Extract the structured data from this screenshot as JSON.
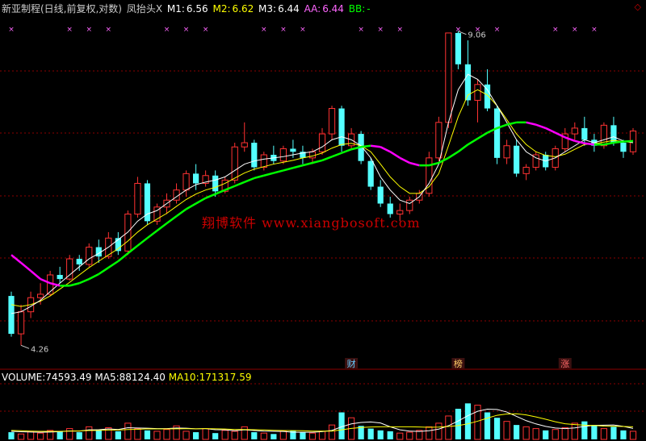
{
  "header": {
    "title": "新亚制程(日线,前复权,对数)",
    "indicator": "凤抬头X",
    "m1_label": "M1:",
    "m1": "6.56",
    "m2_label": "M2:",
    "m2": "6.62",
    "m3_label": "M3:",
    "m3": "6.44",
    "aa_label": "AA:",
    "aa": "6.44",
    "bb_label": "BB:",
    "bb": "-"
  },
  "volume_header": {
    "vol_label": "VOLUME:",
    "vol": "74593.49",
    "ma5_label": "MA5:",
    "ma5": "88124.40",
    "ma10_label": "MA10:",
    "ma10": "171317.59"
  },
  "watermark": "翔博软件 www.xiangbosoft.com",
  "corner_icon": "diamond-icon",
  "annotations": {
    "high": "9.06",
    "low": "4.26"
  },
  "markers": [
    "财",
    "榜",
    "涨"
  ],
  "colors": {
    "up": "#ff3232",
    "down": "#54ffff",
    "flat": "#ffffff",
    "grid": "#8b0000",
    "m1": "#ffffff",
    "m2": "#ffff00",
    "aa_up": "#00ff00",
    "aa_down": "#ff00ff",
    "marker_x": "#ff66ff",
    "label_m1": "#ffffff",
    "label_m2": "#ffff00",
    "label_aa": "#ff66ff",
    "label_ma10": "#ffff00",
    "label_title": "#cccccc"
  },
  "chart_data": [
    {
      "type": "candlestick",
      "title": "新亚制程(日线,前复权,对数)",
      "ylim": [
        4.1,
        9.4
      ],
      "log_scale": true,
      "grid": true,
      "candles": [
        [
          4.8,
          4.85,
          4.35,
          4.38
        ],
        [
          4.38,
          4.7,
          4.26,
          4.62
        ],
        [
          4.62,
          4.85,
          4.55,
          4.78
        ],
        [
          4.78,
          4.95,
          4.7,
          4.82
        ],
        [
          4.82,
          5.1,
          4.8,
          5.05
        ],
        [
          5.05,
          5.15,
          4.95,
          5.0
        ],
        [
          5.0,
          5.3,
          4.98,
          5.25
        ],
        [
          5.25,
          5.3,
          5.1,
          5.18
        ],
        [
          5.18,
          5.45,
          5.15,
          5.4
        ],
        [
          5.4,
          5.5,
          5.2,
          5.28
        ],
        [
          5.28,
          5.6,
          5.25,
          5.52
        ],
        [
          5.52,
          5.6,
          5.3,
          5.35
        ],
        [
          5.35,
          5.9,
          5.3,
          5.85
        ],
        [
          5.85,
          6.4,
          5.8,
          6.3
        ],
        [
          6.3,
          6.35,
          5.7,
          5.75
        ],
        [
          5.75,
          6.0,
          5.7,
          5.95
        ],
        [
          5.95,
          6.15,
          5.85,
          6.05
        ],
        [
          6.05,
          6.3,
          6.0,
          6.2
        ],
        [
          6.2,
          6.5,
          6.1,
          6.45
        ],
        [
          6.45,
          6.6,
          6.2,
          6.3
        ],
        [
          6.3,
          6.5,
          6.25,
          6.42
        ],
        [
          6.42,
          6.5,
          6.1,
          6.18
        ],
        [
          6.18,
          6.4,
          6.15,
          6.35
        ],
        [
          6.35,
          6.95,
          6.3,
          6.88
        ],
        [
          6.88,
          7.3,
          6.8,
          6.95
        ],
        [
          6.95,
          7.0,
          6.5,
          6.55
        ],
        [
          6.55,
          6.8,
          6.5,
          6.75
        ],
        [
          6.75,
          6.9,
          6.6,
          6.65
        ],
        [
          6.65,
          6.9,
          6.6,
          6.85
        ],
        [
          6.85,
          7.0,
          6.7,
          6.8
        ],
        [
          6.8,
          6.9,
          6.6,
          6.7
        ],
        [
          6.7,
          6.85,
          6.6,
          6.8
        ],
        [
          6.8,
          7.2,
          6.75,
          7.1
        ],
        [
          7.1,
          7.6,
          7.0,
          7.55
        ],
        [
          7.55,
          7.6,
          6.8,
          6.9
        ],
        [
          6.9,
          7.2,
          6.85,
          7.1
        ],
        [
          7.1,
          7.15,
          6.6,
          6.65
        ],
        [
          6.65,
          6.7,
          6.2,
          6.25
        ],
        [
          6.25,
          6.35,
          5.95,
          6.0
        ],
        [
          6.0,
          6.1,
          5.8,
          5.85
        ],
        [
          5.85,
          6.0,
          5.75,
          5.9
        ],
        [
          5.9,
          6.1,
          5.85,
          6.05
        ],
        [
          6.05,
          6.2,
          6.0,
          6.15
        ],
        [
          6.15,
          6.8,
          6.1,
          6.7
        ],
        [
          6.7,
          7.4,
          6.65,
          7.3
        ],
        [
          7.3,
          9.06,
          7.2,
          9.06
        ],
        [
          9.06,
          9.1,
          8.3,
          8.4
        ],
        [
          8.4,
          8.9,
          7.6,
          7.7
        ],
        [
          7.7,
          8.1,
          7.3,
          8.0
        ],
        [
          8.0,
          8.3,
          7.5,
          7.55
        ],
        [
          7.55,
          7.6,
          6.6,
          6.7
        ],
        [
          6.7,
          7.0,
          6.6,
          6.9
        ],
        [
          6.9,
          7.0,
          6.4,
          6.45
        ],
        [
          6.45,
          6.6,
          6.35,
          6.55
        ],
        [
          6.55,
          6.8,
          6.5,
          6.75
        ],
        [
          6.75,
          6.8,
          6.5,
          6.55
        ],
        [
          6.55,
          6.9,
          6.5,
          6.85
        ],
        [
          6.85,
          7.2,
          6.8,
          7.1
        ],
        [
          7.1,
          7.3,
          7.0,
          7.2
        ],
        [
          7.2,
          7.4,
          6.9,
          7.0
        ],
        [
          7.0,
          7.1,
          6.8,
          6.9
        ],
        [
          6.9,
          7.3,
          6.85,
          7.25
        ],
        [
          7.25,
          7.4,
          6.9,
          6.95
        ],
        [
          6.95,
          7.0,
          6.7,
          6.8
        ],
        [
          6.8,
          7.2,
          6.75,
          7.15
        ]
      ],
      "series": [
        {
          "name": "M1",
          "values": [
            4.6,
            4.62,
            4.68,
            4.75,
            4.85,
            4.95,
            5.05,
            5.15,
            5.25,
            5.32,
            5.4,
            5.5,
            5.6,
            5.75,
            5.85,
            5.9,
            6.0,
            6.1,
            6.2,
            6.28,
            6.32,
            6.35,
            6.4,
            6.5,
            6.6,
            6.65,
            6.68,
            6.7,
            6.72,
            6.75,
            6.78,
            6.8,
            6.88,
            7.0,
            7.05,
            7.0,
            6.9,
            6.7,
            6.4,
            6.2,
            6.05,
            6.0,
            6.1,
            6.3,
            6.6,
            7.3,
            7.9,
            8.2,
            8.1,
            7.9,
            7.6,
            7.3,
            7.0,
            6.8,
            6.7,
            6.65,
            6.7,
            6.8,
            6.9,
            7.0,
            6.95,
            7.0,
            7.05,
            6.98,
            6.95
          ]
        },
        {
          "name": "M2",
          "values": [
            4.7,
            4.68,
            4.7,
            4.74,
            4.8,
            4.88,
            4.96,
            5.05,
            5.14,
            5.22,
            5.3,
            5.38,
            5.48,
            5.6,
            5.7,
            5.78,
            5.86,
            5.96,
            6.06,
            6.14,
            6.2,
            6.24,
            6.3,
            6.38,
            6.46,
            6.52,
            6.56,
            6.6,
            6.63,
            6.66,
            6.7,
            6.73,
            6.78,
            6.86,
            6.92,
            6.94,
            6.9,
            6.8,
            6.6,
            6.4,
            6.25,
            6.15,
            6.15,
            6.25,
            6.45,
            6.9,
            7.4,
            7.8,
            7.9,
            7.8,
            7.6,
            7.35,
            7.1,
            6.92,
            6.8,
            6.74,
            6.72,
            6.76,
            6.84,
            6.92,
            6.93,
            6.96,
            6.99,
            6.97,
            6.95
          ]
        },
        {
          "name": "AA",
          "values": [
            5.3,
            5.2,
            5.1,
            5.0,
            4.95,
            4.92,
            4.92,
            4.95,
            5.0,
            5.06,
            5.14,
            5.22,
            5.32,
            5.42,
            5.52,
            5.62,
            5.72,
            5.82,
            5.92,
            6.0,
            6.08,
            6.14,
            6.2,
            6.26,
            6.32,
            6.38,
            6.42,
            6.46,
            6.5,
            6.54,
            6.58,
            6.62,
            6.66,
            6.72,
            6.78,
            6.84,
            6.88,
            6.9,
            6.88,
            6.8,
            6.7,
            6.62,
            6.58,
            6.58,
            6.62,
            6.7,
            6.8,
            6.92,
            7.02,
            7.12,
            7.2,
            7.26,
            7.3,
            7.3,
            7.26,
            7.2,
            7.12,
            7.04,
            6.98,
            6.94,
            6.92,
            6.92,
            6.95,
            6.97,
            6.98
          ]
        }
      ]
    },
    {
      "type": "bar",
      "title": "VOLUME",
      "ylim": [
        0,
        60000
      ],
      "values": [
        8000,
        6000,
        9000,
        7000,
        10000,
        9000,
        12000,
        8000,
        14000,
        11000,
        13000,
        9000,
        18000,
        12000,
        10000,
        9000,
        11000,
        15000,
        9000,
        8000,
        12000,
        7000,
        10000,
        9000,
        14000,
        8000,
        7000,
        6000,
        9000,
        10000,
        8000,
        7000,
        9000,
        16000,
        30000,
        24000,
        15000,
        12000,
        10000,
        9000,
        7000,
        8000,
        10000,
        14000,
        18000,
        26000,
        34000,
        40000,
        38000,
        30000,
        24000,
        20000,
        16000,
        14000,
        12000,
        10000,
        11000,
        13000,
        18000,
        20000,
        16000,
        12000,
        14000,
        10000,
        9000
      ],
      "series": [
        {
          "name": "MA5",
          "values": [
            9000,
            8500,
            8200,
            8000,
            8200,
            8600,
            9400,
            9200,
            10600,
            10800,
            11600,
            11000,
            13000,
            12600,
            12400,
            12000,
            12000,
            12600,
            12400,
            11800,
            12000,
            10800,
            10600,
            9600,
            10600,
            9800,
            9200,
            9000,
            8800,
            8000,
            8000,
            8000,
            8600,
            10000,
            14000,
            17200,
            18800,
            19400,
            18200,
            14000,
            10600,
            9200,
            8800,
            9600,
            11400,
            15200,
            20400,
            26400,
            31200,
            33600,
            33200,
            30400,
            25600,
            20800,
            17200,
            14400,
            12600,
            12000,
            12800,
            14400,
            15600,
            15800,
            16000,
            14400,
            12200
          ]
        },
        {
          "name": "MA10",
          "values": [
            10000,
            9600,
            9200,
            9000,
            9000,
            9000,
            9200,
            9400,
            9800,
            10000,
            10400,
            10400,
            11000,
            11200,
            11800,
            11600,
            11600,
            11800,
            11900,
            11800,
            12000,
            11800,
            11500,
            11000,
            11000,
            10800,
            10500,
            10100,
            9900,
            9700,
            9600,
            9200,
            9200,
            9200,
            10600,
            12200,
            13200,
            13800,
            14000,
            14000,
            14000,
            14000,
            13800,
            13400,
            13700,
            14300,
            15300,
            17300,
            20200,
            23600,
            26800,
            28200,
            28400,
            27200,
            25000,
            22400,
            19600,
            17400,
            16500,
            15800,
            15400,
            14800,
            14600,
            14300,
            14000
          ]
        }
      ]
    }
  ]
}
